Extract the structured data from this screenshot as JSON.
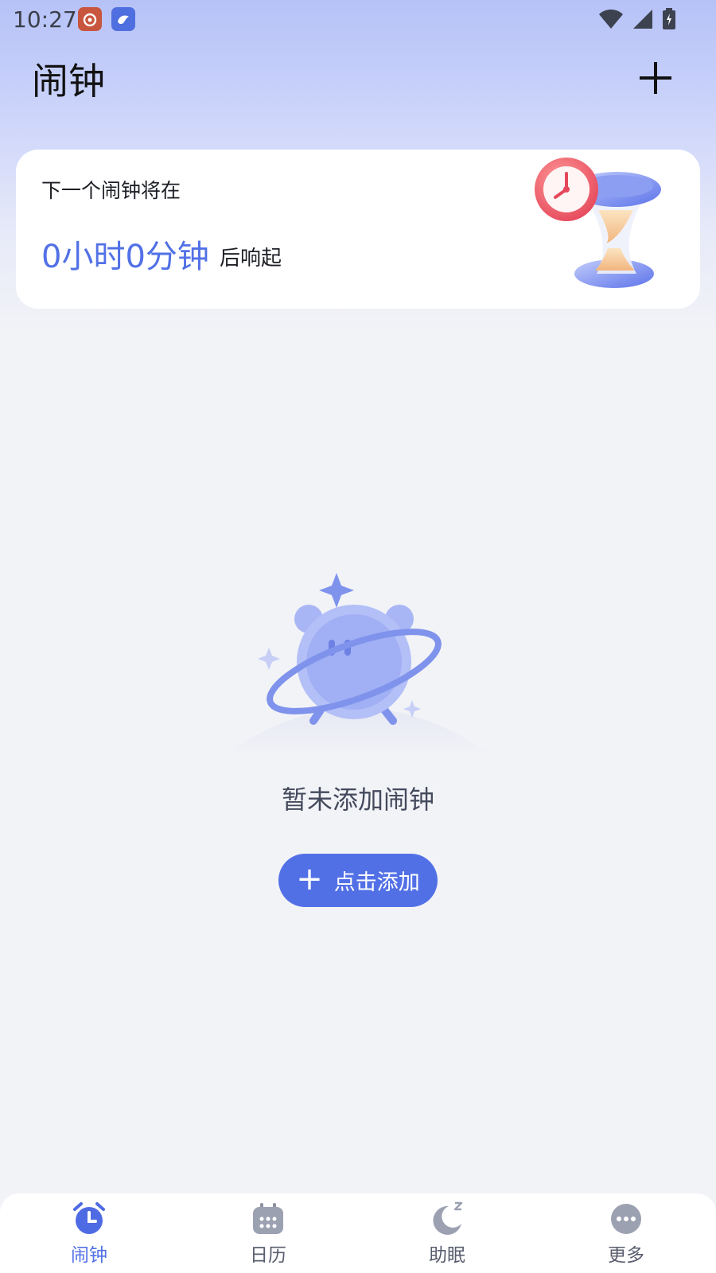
{
  "status_bar": {
    "time": "10:27",
    "apps": [
      "weibo-icon",
      "bird-app-icon"
    ]
  },
  "header": {
    "title": "闹钟",
    "add_icon": "plus-icon"
  },
  "next_alarm": {
    "label": "下一个闹钟将在",
    "countdown": "0小时0分钟",
    "suffix": "后响起",
    "illustration": "hourglass-clock-illustration"
  },
  "empty_state": {
    "illustration": "alarm-clock-planet-illustration",
    "message": "暂未添加闹钟",
    "button_label": "点击添加"
  },
  "bottom_nav": {
    "items": [
      {
        "label": "闹钟",
        "icon": "alarm-clock-icon",
        "active": true
      },
      {
        "label": "日历",
        "icon": "calendar-icon",
        "active": false
      },
      {
        "label": "助眠",
        "icon": "moon-sleep-icon",
        "active": false
      },
      {
        "label": "更多",
        "icon": "more-dots-icon",
        "active": false
      }
    ]
  },
  "colors": {
    "accent": "#5271E6",
    "background": "#F2F3F7",
    "header_gradient": "#B6C2F7"
  }
}
